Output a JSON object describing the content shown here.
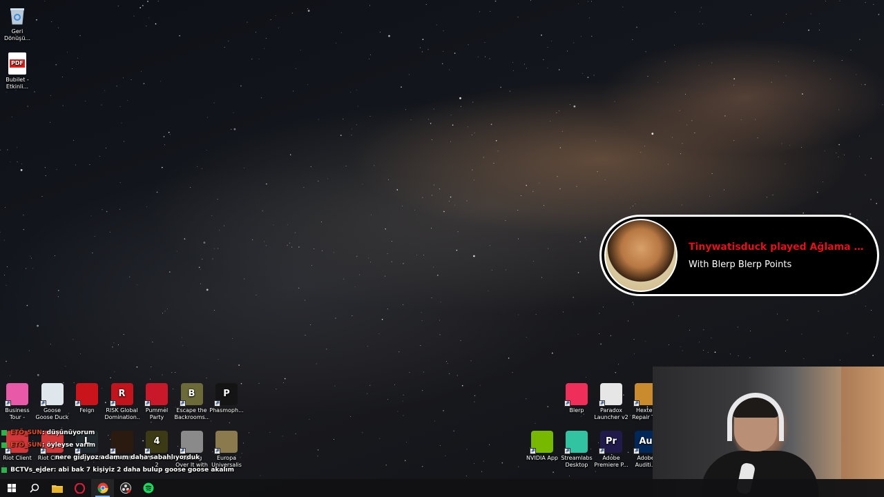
{
  "desktop": {
    "left_column": [
      {
        "label": "Geri Dönüşü...",
        "icon": "recycle-bin-icon"
      },
      {
        "label": "Bubilet - Etkinli...",
        "icon": "pdf-file-icon",
        "badge": "PDF"
      }
    ],
    "row1": [
      {
        "label": "Business Tour - Online M...",
        "icon": "business-tour-icon",
        "color": "#e85aa8"
      },
      {
        "label": "Goose Goose Duck",
        "icon": "goose-icon",
        "color": "#dfe6ec"
      },
      {
        "label": "Feign",
        "icon": "feign-icon",
        "color": "#c8141a"
      },
      {
        "label": "RISK Global Domination...",
        "icon": "risk-icon",
        "color": "#c2141d",
        "glyph": "R"
      },
      {
        "label": "Pummel Party",
        "icon": "pummel-party-icon",
        "color": "#c9182a"
      },
      {
        "label": "Escape the Backrooms...",
        "icon": "backrooms-icon",
        "color": "#6d6a3a",
        "glyph": "B"
      },
      {
        "label": "Phasmoph...",
        "icon": "phasmophobia-icon",
        "color": "#141414",
        "glyph": "P"
      }
    ],
    "row2": [
      {
        "label": "Riot Client",
        "icon": "riot-client-icon",
        "color": "#d13639"
      },
      {
        "label": "Riot Client",
        "icon": "riot-client-icon",
        "color": "#d13639"
      },
      {
        "label": "League of",
        "icon": "league-icon",
        "color": "#1f2a2e",
        "glyph": "L"
      },
      {
        "label": "DEVOUR",
        "icon": "devour-icon",
        "color": "#2a1a10"
      },
      {
        "label": "Left 4 Dead 2",
        "icon": "left4dead-icon",
        "color": "#3c3a14",
        "glyph": "4"
      },
      {
        "label": "Getting Over It with Ben...",
        "icon": "hammer-icon",
        "color": "#8a8a8a"
      },
      {
        "label": "Europa Universalis IV",
        "icon": "europa-icon",
        "color": "#8a7a4e"
      }
    ],
    "right_row1": [
      {
        "label": "Blerp",
        "icon": "blerp-icon",
        "color": "#ef2e5a"
      },
      {
        "label": "Paradox Launcher v2",
        "icon": "paradox-icon",
        "color": "#e6e6e6"
      },
      {
        "label": "Hextec Repair T...",
        "icon": "hextech-icon",
        "color": "#c98b2e"
      }
    ],
    "right_row2": [
      {
        "label": "NVIDIA App",
        "icon": "nvidia-icon",
        "color": "#76b900"
      },
      {
        "label": "Streamlabs Desktop",
        "icon": "streamlabs-icon",
        "color": "#31c3a2"
      },
      {
        "label": "Adobe Premiere P...",
        "icon": "premiere-icon",
        "color": "#1f1a4a",
        "glyph": "Pr"
      },
      {
        "label": "Adobe Auditi...",
        "icon": "audition-icon",
        "color": "#00275a",
        "glyph": "Au"
      }
    ]
  },
  "alert": {
    "title": "Tinywatisduck played Ağlama H...",
    "subtitle": "With Blerp Blerp Points"
  },
  "chat": [
    {
      "user": "ETÖ_SUN",
      "message": ": düşünüyorum"
    },
    {
      "user": "ETÖ_SUN",
      "message": ": öyleyse varım"
    },
    {
      "user": "",
      "message": "nere gidiyoz adamım daha sabahlıyorduk"
    },
    {
      "user": "BCTVs_ejder",
      "message": ": abi bak 7 kişiyiz 2 daha bulup goose goose akalım"
    }
  ],
  "taskbar": {
    "items": [
      {
        "name": "start-button",
        "icon": "windows-icon"
      },
      {
        "name": "search-button",
        "icon": "search-icon"
      },
      {
        "name": "file-explorer",
        "icon": "folder-icon"
      },
      {
        "name": "opera-gx",
        "icon": "opera-icon"
      },
      {
        "name": "chrome",
        "icon": "chrome-icon",
        "active": true
      },
      {
        "name": "obs",
        "icon": "obs-icon"
      },
      {
        "name": "spotify",
        "icon": "spotify-icon"
      }
    ]
  }
}
